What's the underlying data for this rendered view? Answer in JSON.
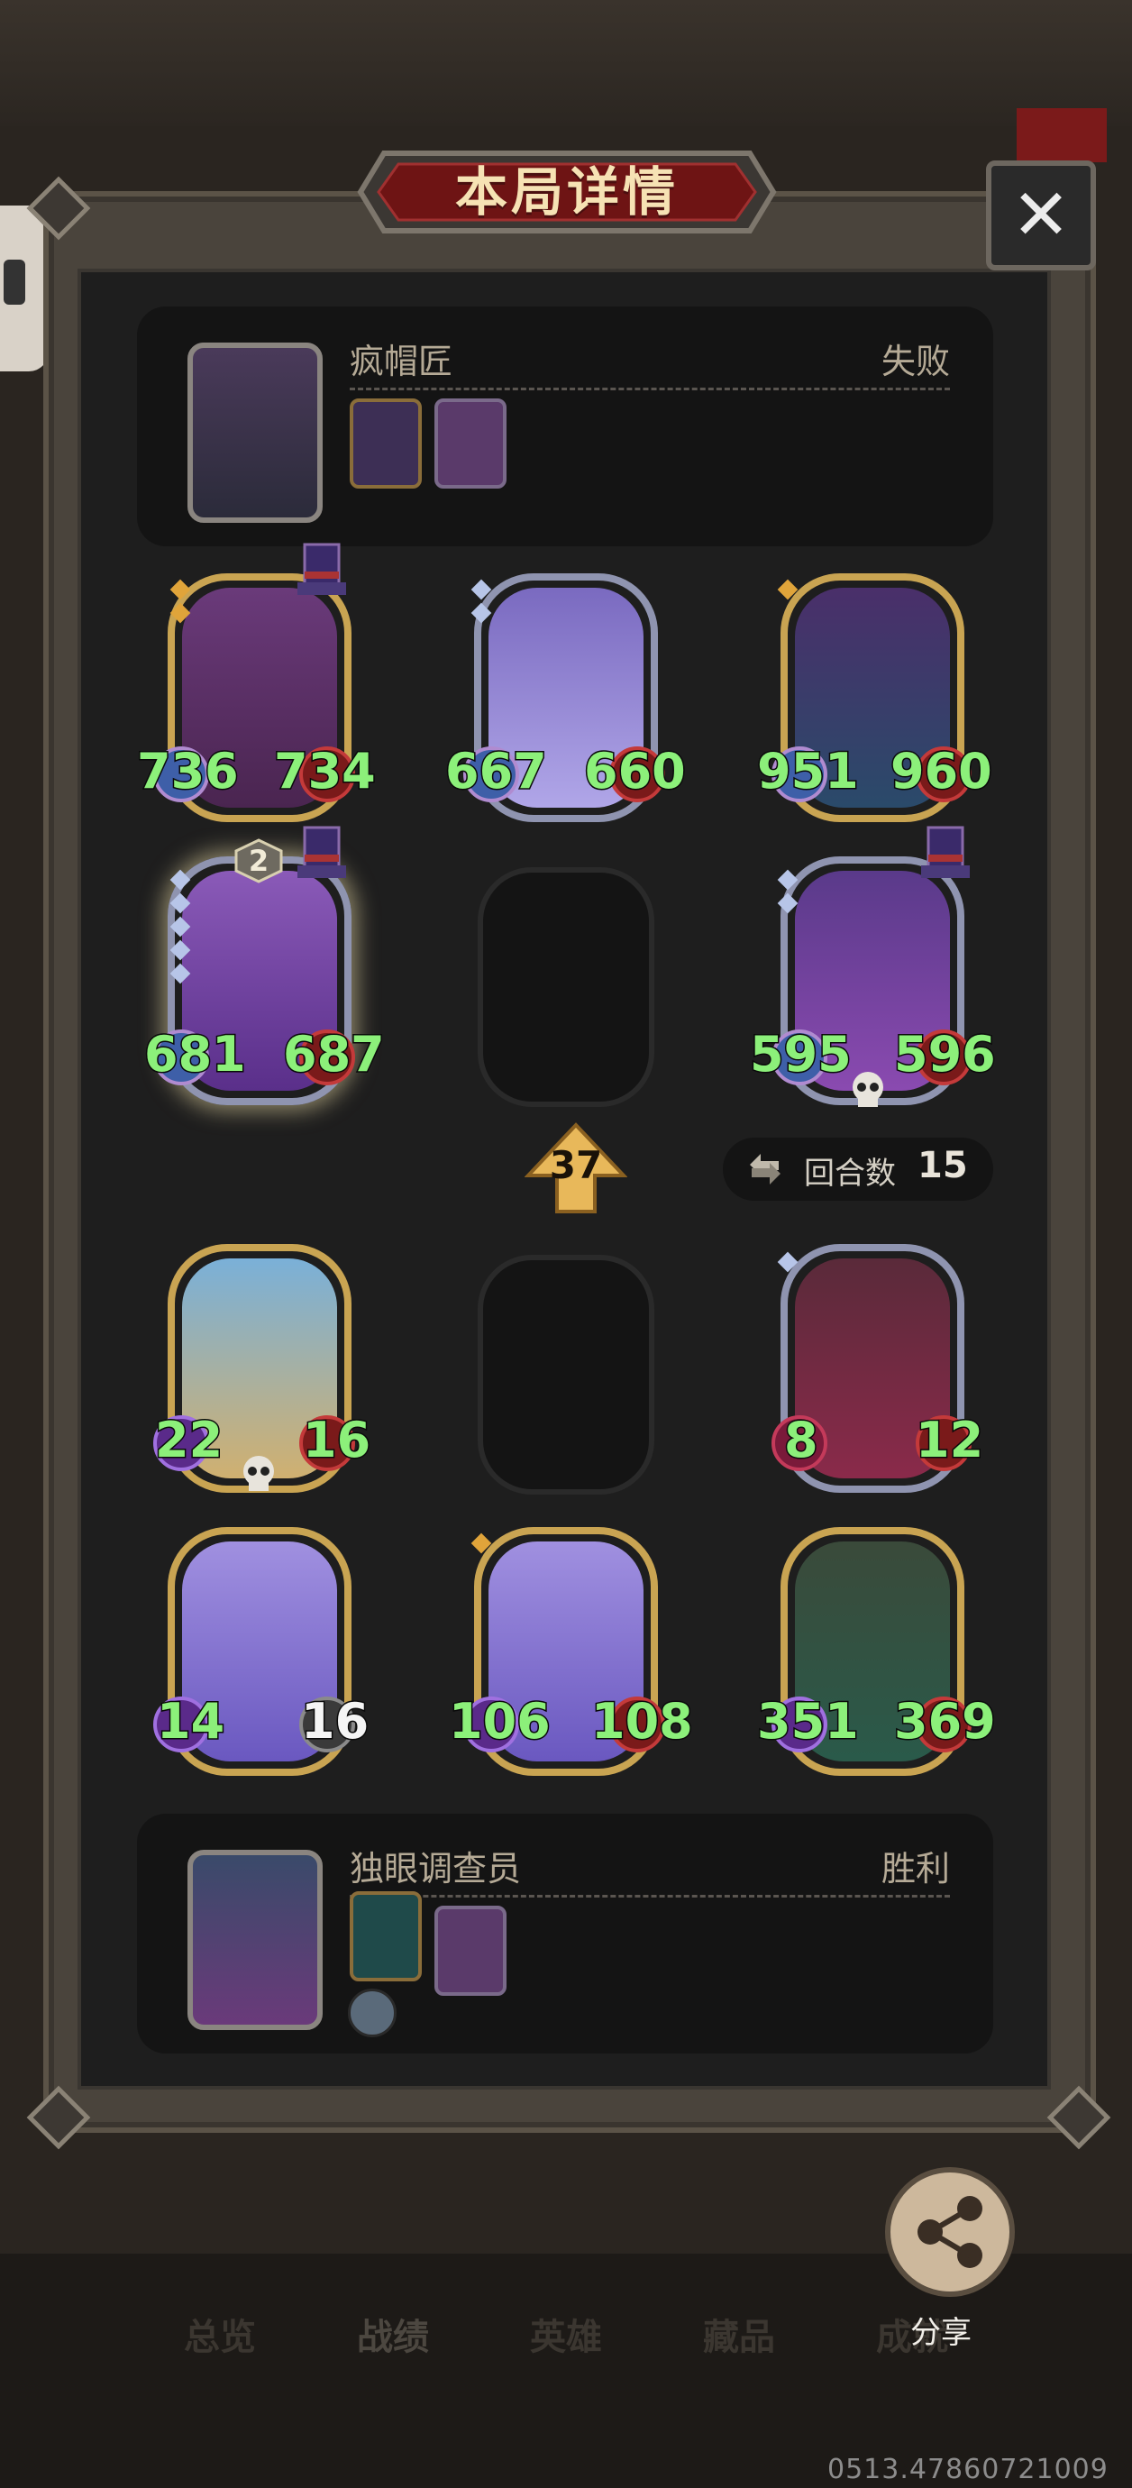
{
  "header": {
    "title": "本局详情",
    "close_label": "✕"
  },
  "opponent": {
    "name": "疯帽匠",
    "result": "失败",
    "portrait_icon": "mad-hatter-portrait-icon"
  },
  "opponent_board": [
    {
      "icon": "rabbit-mask-card-icon",
      "attack": "736",
      "health": "734",
      "frame": "gold",
      "has_hat": true
    },
    {
      "icon": "fox-card-icon",
      "attack": "667",
      "health": "660",
      "frame": "silver",
      "has_hat": false
    },
    {
      "icon": "elf-witch-card-icon",
      "attack": "951",
      "health": "960",
      "frame": "gold",
      "has_hat": false
    },
    {
      "icon": "blonde-fairy-card-icon",
      "attack": "681",
      "health": "687",
      "frame": "silver",
      "has_hat": true,
      "level_badge": "2"
    },
    {
      "icon": "mage-elf-card-icon",
      "attack": "595",
      "health": "596",
      "frame": "silver",
      "has_hat": true
    }
  ],
  "round": {
    "level": "37",
    "turns_label": "回合数",
    "turns_value": "15"
  },
  "player_board": [
    {
      "icon": "pelican-card-icon",
      "attack": "22",
      "health": "16",
      "frame": "gold"
    },
    {
      "icon": "clown-card-icon",
      "attack": "8",
      "health": "12",
      "frame": "silver"
    },
    {
      "icon": "flower-fairy-card-icon",
      "attack": "14",
      "health": "16",
      "frame": "gold",
      "health_white": true
    },
    {
      "icon": "flower-fairy-card-icon",
      "attack": "106",
      "health": "108",
      "frame": "gold"
    },
    {
      "icon": "treant-card-icon",
      "attack": "351",
      "health": "369",
      "frame": "gold"
    }
  ],
  "player": {
    "name": "独眼调查员",
    "result": "胜利",
    "portrait_icon": "archer-hero-portrait-icon"
  },
  "bottom_nav": [
    "总览",
    "战绩",
    "英雄",
    "藏品",
    "成就"
  ],
  "share": {
    "label": "分享"
  },
  "watermark": "0513.47860721009",
  "colors": {
    "stat_green": "#8cf07a",
    "gold_frame": "#c9a452",
    "silver_frame": "#8f94b0",
    "banner_red": "#7b1a1a"
  }
}
